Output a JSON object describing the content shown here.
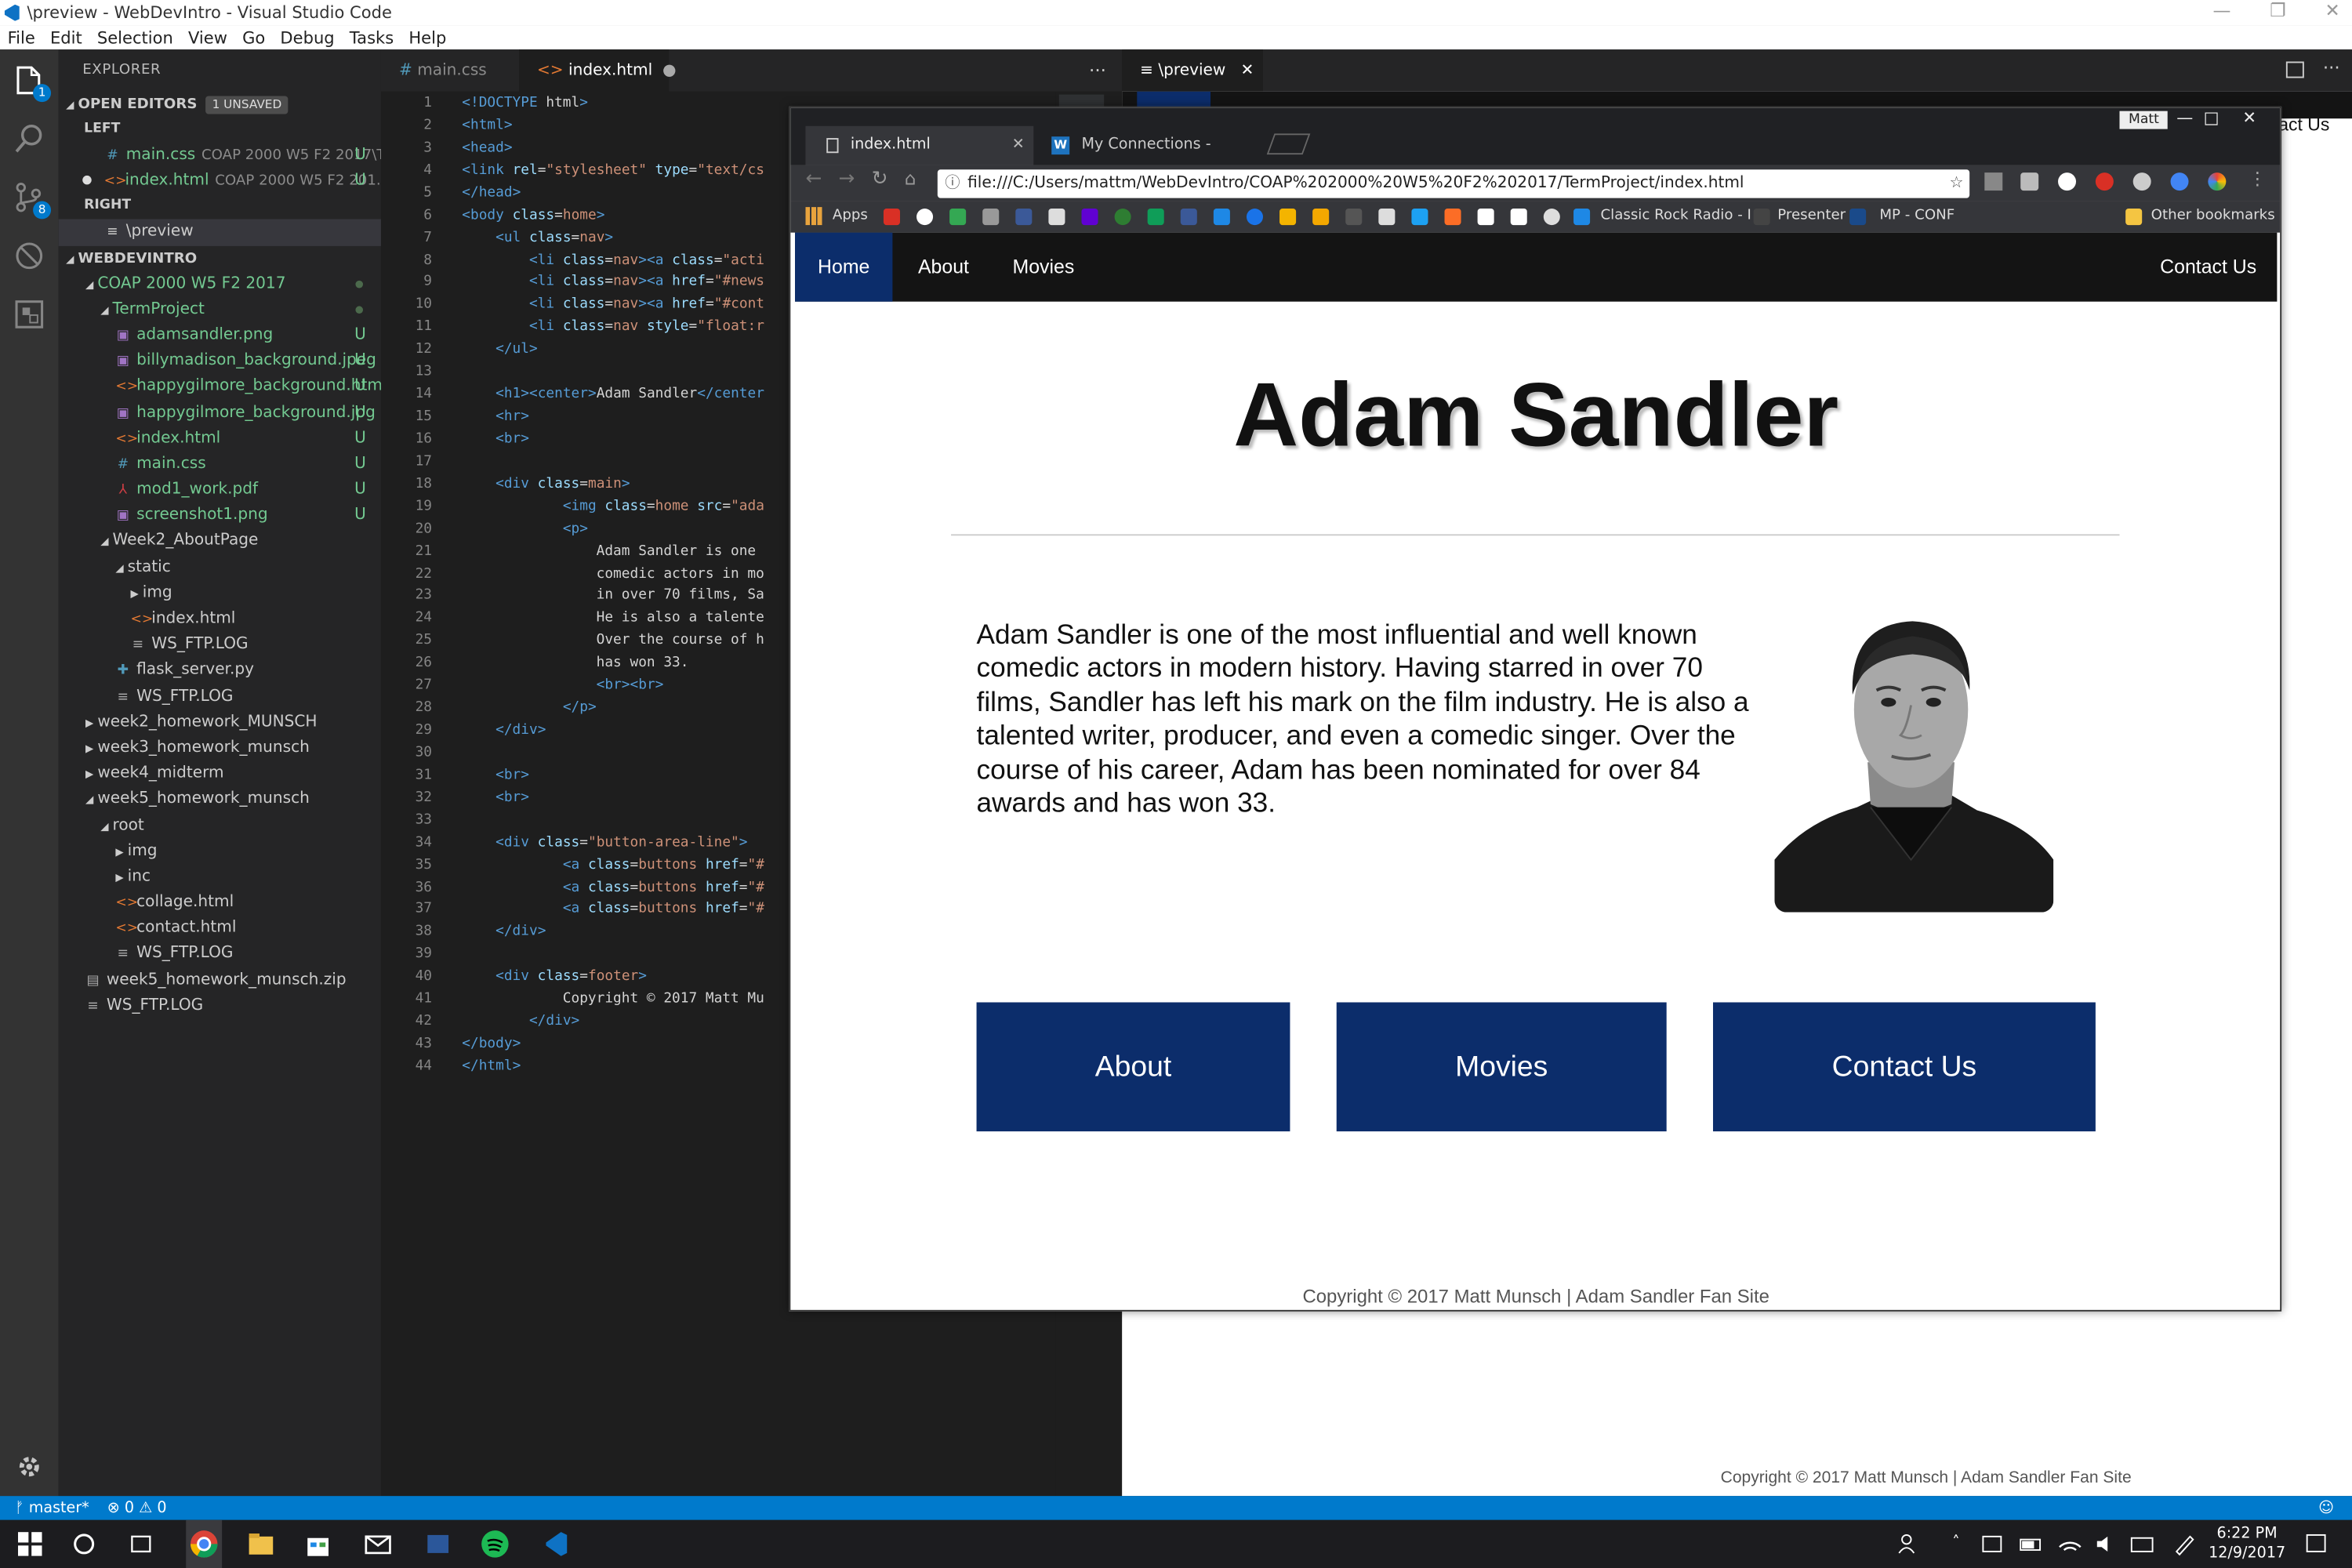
{
  "window": {
    "title": "\\preview - WebDevIntro - Visual Studio Code",
    "controls": [
      "—",
      "❐",
      "✕"
    ]
  },
  "menu": [
    "File",
    "Edit",
    "Selection",
    "View",
    "Go",
    "Debug",
    "Tasks",
    "Help"
  ],
  "activity_badges": {
    "explorer": "1",
    "git": "8"
  },
  "sidebar": {
    "title": "EXPLORER",
    "open_editors": {
      "label": "OPEN EDITORS",
      "badge": "1 UNSAVED"
    },
    "left_group": "LEFT",
    "right_group": "RIGHT",
    "open_left": [
      {
        "icon": "#",
        "name": "main.css",
        "desc": "COAP 2000 W5 F2 2017\\T...",
        "status": "U"
      },
      {
        "icon": "<>",
        "name": "index.html",
        "desc": "COAP 2000 W5 F2 201...",
        "status": "U"
      }
    ],
    "open_right": [
      {
        "icon": "≡",
        "name": "\\preview"
      }
    ],
    "workspace": "WEBDEVINTRO",
    "tree": [
      {
        "name": "COAP 2000 W5 F2 2017",
        "indent": 1,
        "tri": "◢",
        "green": true,
        "dot": true
      },
      {
        "name": "TermProject",
        "indent": 2,
        "tri": "◢",
        "green": true,
        "dot": true
      },
      {
        "name": "adamsandler.png",
        "indent": 3,
        "icon": "img",
        "green": true,
        "status": "U"
      },
      {
        "name": "billymadison_background.jpeg",
        "indent": 3,
        "icon": "img",
        "green": true,
        "status": "U"
      },
      {
        "name": "happygilmore_background.html",
        "indent": 3,
        "icon": "html",
        "green": true,
        "status": "U"
      },
      {
        "name": "happygilmore_background.jpg",
        "indent": 3,
        "icon": "img",
        "green": true,
        "status": "U"
      },
      {
        "name": "index.html",
        "indent": 3,
        "icon": "html",
        "green": true,
        "status": "U"
      },
      {
        "name": "main.css",
        "indent": 3,
        "icon": "css",
        "green": true,
        "status": "U"
      },
      {
        "name": "mod1_work.pdf",
        "indent": 3,
        "icon": "pdf",
        "green": true,
        "status": "U"
      },
      {
        "name": "screenshot1.png",
        "indent": 3,
        "icon": "img",
        "green": true,
        "status": "U"
      },
      {
        "name": "Week2_AboutPage",
        "indent": 2,
        "tri": "◢"
      },
      {
        "name": "static",
        "indent": 3,
        "tri": "◢"
      },
      {
        "name": "img",
        "indent": 4,
        "tri": "▶"
      },
      {
        "name": "index.html",
        "indent": 4,
        "icon": "html"
      },
      {
        "name": "WS_FTP.LOG",
        "indent": 4,
        "icon": "txt"
      },
      {
        "name": "flask_server.py",
        "indent": 3,
        "icon": "py"
      },
      {
        "name": "WS_FTP.LOG",
        "indent": 3,
        "icon": "txt"
      },
      {
        "name": "week2_homework_MUNSCH",
        "indent": 1,
        "tri": "▶"
      },
      {
        "name": "week3_homework_munsch",
        "indent": 1,
        "tri": "▶"
      },
      {
        "name": "week4_midterm",
        "indent": 1,
        "tri": "▶"
      },
      {
        "name": "week5_homework_munsch",
        "indent": 1,
        "tri": "◢"
      },
      {
        "name": "root",
        "indent": 2,
        "tri": "◢"
      },
      {
        "name": "img",
        "indent": 3,
        "tri": "▶"
      },
      {
        "name": "inc",
        "indent": 3,
        "tri": "▶"
      },
      {
        "name": "collage.html",
        "indent": 3,
        "icon": "html"
      },
      {
        "name": "contact.html",
        "indent": 3,
        "icon": "html"
      },
      {
        "name": "WS_FTP.LOG",
        "indent": 3,
        "icon": "txt"
      },
      {
        "name": "week5_homework_munsch.zip",
        "indent": 1,
        "icon": "zip"
      },
      {
        "name": "WS_FTP.LOG",
        "indent": 1,
        "icon": "txt"
      }
    ]
  },
  "editor_tabs": [
    {
      "icon": "#",
      "label": "main.css"
    },
    {
      "icon": "<>",
      "label": "index.html",
      "modified": "●"
    }
  ],
  "editor_more": "···",
  "preview_tab": {
    "icon": "≡",
    "label": "\\preview",
    "close": "✕"
  },
  "code_lines": [
    "<!DOCTYPE html>",
    "<html>",
    "<head>",
    "<link rel=\"stylesheet\" type=\"text/cs",
    "</head>",
    "<body class=home>",
    "    <ul class=nav>",
    "        <li class=nav><a class=\"acti",
    "        <li class=nav><a href=\"#news",
    "        <li class=nav><a href=\"#cont",
    "        <li class=nav style=\"float:r",
    "    </ul>",
    "",
    "    <h1><center>Adam Sandler</center",
    "    <hr>",
    "    <br>",
    "",
    "    <div class=main>",
    "            <img class=home src=\"ada",
    "            <p>",
    "                Adam Sandler is one ",
    "                comedic actors in mo",
    "                in over 70 films, Sa",
    "                He is also a talente",
    "                Over the course of h",
    "                has won 33.",
    "                <br><br>",
    "            </p>",
    "    </div>",
    "",
    "    <br>",
    "    <br>",
    "",
    "    <div class=\"button-area-line\">",
    "            <a class=buttons href=\"#",
    "            <a class=buttons href=\"#",
    "            <a class=buttons href=\"#",
    "    </div>",
    "",
    "    <div class=footer>",
    "            Copyright © 2017 Matt Mu",
    "        </div>",
    "</body>",
    "</html>"
  ],
  "preview_bg": {
    "nav_right": "tact Us",
    "footer": "Copyright © 2017 Matt Munsch | Adam Sandler Fan Site"
  },
  "status": {
    "branch": "master*",
    "errors": "0",
    "warnings": "0"
  },
  "taskbar": {
    "time": "6:22 PM",
    "date": "12/9/2017"
  },
  "chrome": {
    "profile": "Matt",
    "tabs": [
      {
        "label": "index.html",
        "close": "✕"
      },
      {
        "label": "My Connections - Webst",
        "close": "✕"
      }
    ],
    "url": "file:///C:/Users/mattm/WebDevIntro/COAP%202000%20W5%20F2%202017/TermProject/index.html",
    "bookmarks": {
      "apps": "Apps",
      "classic_rock": "Classic Rock Radio - I",
      "presenter": "Presenter",
      "mp_conf": "MP - CONF",
      "other": "Other bookmarks"
    }
  },
  "site": {
    "nav": [
      "Home",
      "About",
      "Movies"
    ],
    "nav_right": "Contact Us",
    "heading": "Adam Sandler",
    "paragraph": "Adam Sandler is one of the most influential and well known comedic actors in modern history. Having starred in over 70 films, Sandler has left his mark on the film industry. He is also a talented writer, producer, and even a comedic singer. Over the course of his career, Adam has been nominated for over 84 awards and has won 33.",
    "buttons": [
      "About",
      "Movies",
      "Contact Us"
    ],
    "footer": "Copyright © 2017 Matt Munsch | Adam Sandler Fan Site"
  },
  "colors": {
    "vscode_bg": "#1e1e1e",
    "sidebar_bg": "#252526",
    "statusbar": "#007acc",
    "site_nav": "#141414",
    "site_accent": "#0c2d6b",
    "untracked_green": "#73c991"
  }
}
